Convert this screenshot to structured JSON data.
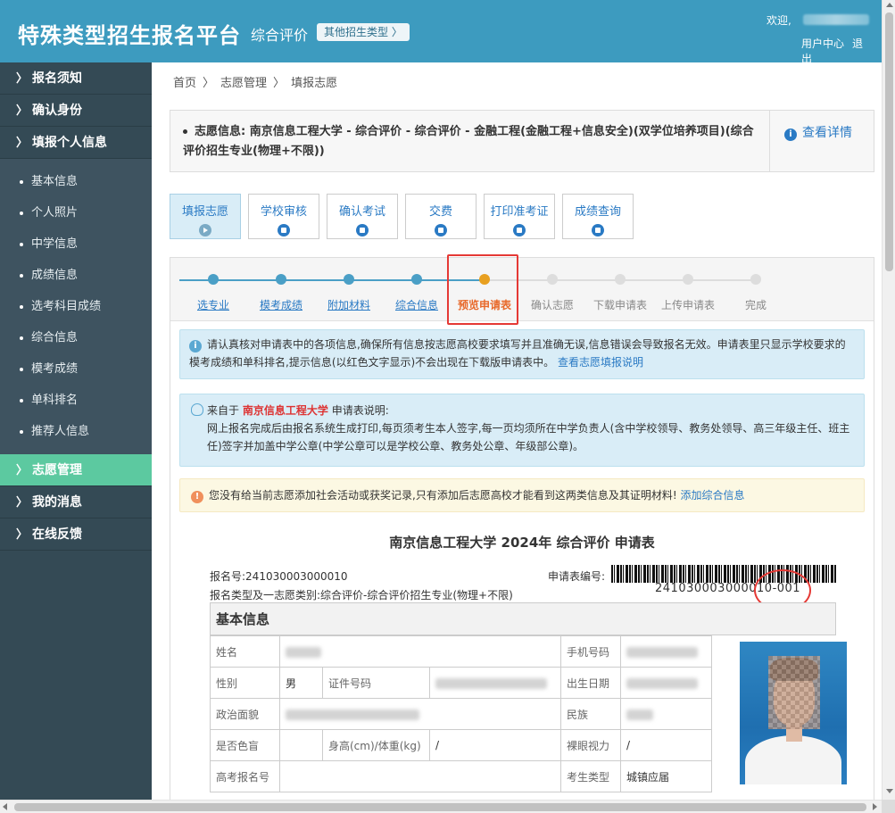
{
  "header": {
    "brand": "特殊类型招生报名平台",
    "subtitle": "综合评价",
    "other_type_label": "其他招生类型 〉",
    "welcome": "欢迎,",
    "user_center": "用户中心",
    "logout": "退出"
  },
  "sidebar": {
    "main_items": [
      {
        "label": "报名须知"
      },
      {
        "label": "确认身份"
      },
      {
        "label": "填报个人信息"
      }
    ],
    "sub_items": [
      {
        "label": "基本信息"
      },
      {
        "label": "个人照片"
      },
      {
        "label": "中学信息"
      },
      {
        "label": "成绩信息"
      },
      {
        "label": "选考科目成绩"
      },
      {
        "label": "综合信息"
      },
      {
        "label": "模考成绩"
      },
      {
        "label": "单科排名"
      },
      {
        "label": "推荐人信息"
      }
    ],
    "bottom_items": [
      {
        "label": "志愿管理",
        "active": true
      },
      {
        "label": "我的消息"
      },
      {
        "label": "在线反馈"
      }
    ]
  },
  "breadcrumb": {
    "items": [
      "首页",
      "志愿管理",
      "填报志愿"
    ],
    "separator": "〉"
  },
  "info": {
    "label": "志愿信息:",
    "text": "南京信息工程大学 - 综合评价 - 综合评价 - 金融工程(金融工程+信息安全)(双学位培养项目)(综合评价招生专业(物理+不限))",
    "detail_link": "查看详情"
  },
  "tabs": [
    {
      "label": "填报志愿",
      "active": true
    },
    {
      "label": "学校审核"
    },
    {
      "label": "确认考试"
    },
    {
      "label": "交费"
    },
    {
      "label": "打印准考证"
    },
    {
      "label": "成绩查询"
    }
  ],
  "steps": [
    {
      "label": "选专业",
      "state": "done"
    },
    {
      "label": "模考成绩",
      "state": "done"
    },
    {
      "label": "附加材料",
      "state": "done"
    },
    {
      "label": "综合信息",
      "state": "done"
    },
    {
      "label": "预览申请表",
      "state": "current"
    },
    {
      "label": "确认志愿",
      "state": "todo"
    },
    {
      "label": "下载申请表",
      "state": "todo"
    },
    {
      "label": "上传申请表",
      "state": "todo"
    },
    {
      "label": "完成",
      "state": "todo"
    }
  ],
  "notice1": {
    "text": "请认真核对申请表中的各项信息,确保所有信息按志愿高校要求填写并且准确无误,信息错误会导致报名无效。申请表里只显示学校要求的模考成绩和单科排名,提示信息(以红色文字显示)不会出现在下载版申请表中。",
    "link": "查看志愿填报说明"
  },
  "notice2": {
    "prefix": "来自于",
    "school": "南京信息工程大学",
    "suffix": "申请表说明:",
    "body": "网上报名完成后由报名系统生成打印,每页须考生本人签字,每一页均须所在中学负责人(含中学校领导、教务处领导、高三年级主任、班主任)签字并加盖中学公章(中学公章可以是学校公章、教务处公章、年级部公章)。"
  },
  "notice3": {
    "text": "您没有给当前志愿添加社会活动或获奖记录,只有添加后志愿高校才能看到这两类信息及其证明材料!",
    "link": "添加综合信息"
  },
  "form": {
    "title": "南京信息工程大学 2024年 综合评价 申请表",
    "reg_no_label": "报名号:",
    "reg_no": "241030003000010",
    "app_no_label": "申请表编号:",
    "app_no": "241030003000010-001",
    "type_label": "报名类型及一志愿类别:",
    "type_value": "综合评价-综合评价招生专业(物理+不限)",
    "section": "基本信息",
    "rows": {
      "name": "姓名",
      "phone": "手机号码",
      "gender": "性别",
      "gender_value": "男",
      "id_no": "证件号码",
      "birth": "出生日期",
      "political": "政治面貌",
      "ethnicity": "民族",
      "color_blind": "是否色盲",
      "height_weight": "身高(cm)/体重(kg)",
      "height_weight_value": "/",
      "vision": "裸眼视力",
      "vision_value": "/",
      "exam_no": "高考报名号",
      "student_type": "考生类型",
      "student_type_value": "城镇应届"
    }
  },
  "colors": {
    "header": "#3d9bbf",
    "sidebar": "#344a55",
    "sidebar_active": "#5cc9a0",
    "link": "#2a7ac4",
    "highlight": "#e53935"
  }
}
